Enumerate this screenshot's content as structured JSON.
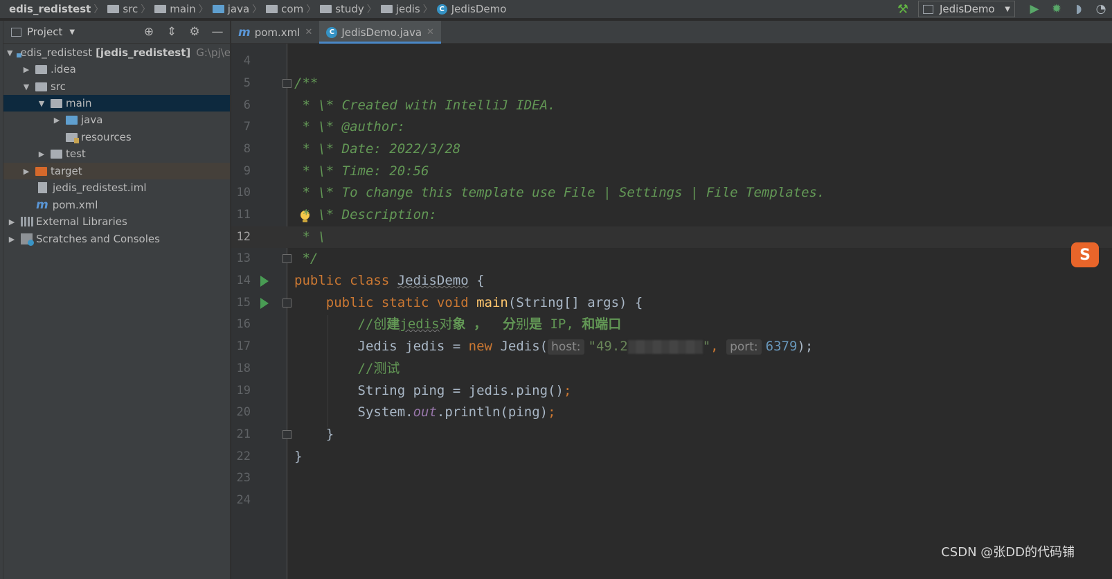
{
  "breadcrumbs": [
    "edis_redistest",
    "src",
    "main",
    "java",
    "com",
    "study",
    "jedis",
    "JedisDemo"
  ],
  "run_config": {
    "name": "JedisDemo"
  },
  "project_panel": {
    "title": "Project"
  },
  "tree": {
    "root_name": "edis_redistest",
    "root_module": "[jedis_redistest]",
    "root_path": "G:\\pj\\ec",
    "idea": ".idea",
    "src": "src",
    "main": "main",
    "java": "java",
    "resources": "resources",
    "test": "test",
    "target": "target",
    "iml": "jedis_redistest.iml",
    "pom": "pom.xml",
    "ext_libs": "External Libraries",
    "scratches": "Scratches and Consoles"
  },
  "tabs": [
    {
      "label": "pom.xml",
      "active": false
    },
    {
      "label": "JedisDemo.java",
      "active": true
    }
  ],
  "line_numbers": [
    "4",
    "5",
    "6",
    "7",
    "8",
    "9",
    "10",
    "11",
    "12",
    "13",
    "14",
    "15",
    "16",
    "17",
    "18",
    "19",
    "20",
    "21",
    "22",
    "23",
    "24"
  ],
  "code": {
    "l5": "/**",
    "l6": " * \\* Created with IntelliJ IDEA.",
    "l7": " * \\* @author:",
    "l8": " * \\* Date: 2022/3/28",
    "l9": " * \\* Time: 20:56",
    "l10": " * \\* To change this template use File | Settings | File Templates.",
    "l11": " * \\* Description:",
    "l12": " * \\",
    "l13": " */",
    "l14_kw": "public class ",
    "l14_name": "JedisDemo",
    "l14_end": " {",
    "l15_kw": "    public static void ",
    "l15_fn": "main",
    "l15_end": "(String[] args) {",
    "l16_a": "        //创",
    "l16_b": "建",
    "l16_c": "jedis",
    "l16_d": "对",
    "l16_e": "象",
    "l16_f": " ，  ",
    "l16_g": "分",
    "l16_h": "别",
    "l16_i": "是",
    "l16_j": " IP, ",
    "l16_k": "和端口",
    "l17_a": "        Jedis jedis = ",
    "l17_new": "new",
    "l17_b": " Jedis(",
    "l17_host_hint": "host:",
    "l17_str_a": "\"49.2",
    "l17_str_b": "\"",
    "l17_comma": ",",
    "l17_port_hint": "port:",
    "l17_port": "6379",
    "l17_end": ");",
    "l18": "        //测试",
    "l19_a": "        String ping = jedis.ping()",
    "l19_semi": ";",
    "l20_a": "        System.",
    "l20_out": "out",
    "l20_b": ".println(ping)",
    "l20_semi": ";",
    "l21": "    }",
    "l22": "}"
  },
  "watermark": "CSDN @张DD的代码铺",
  "side_logo": "S",
  "colors": {
    "keyword": "#cc7832",
    "doc_comment": "#629755",
    "method": "#ffc66d",
    "string": "#6a8759",
    "number": "#6897bb",
    "accent": "#4a88c7"
  }
}
